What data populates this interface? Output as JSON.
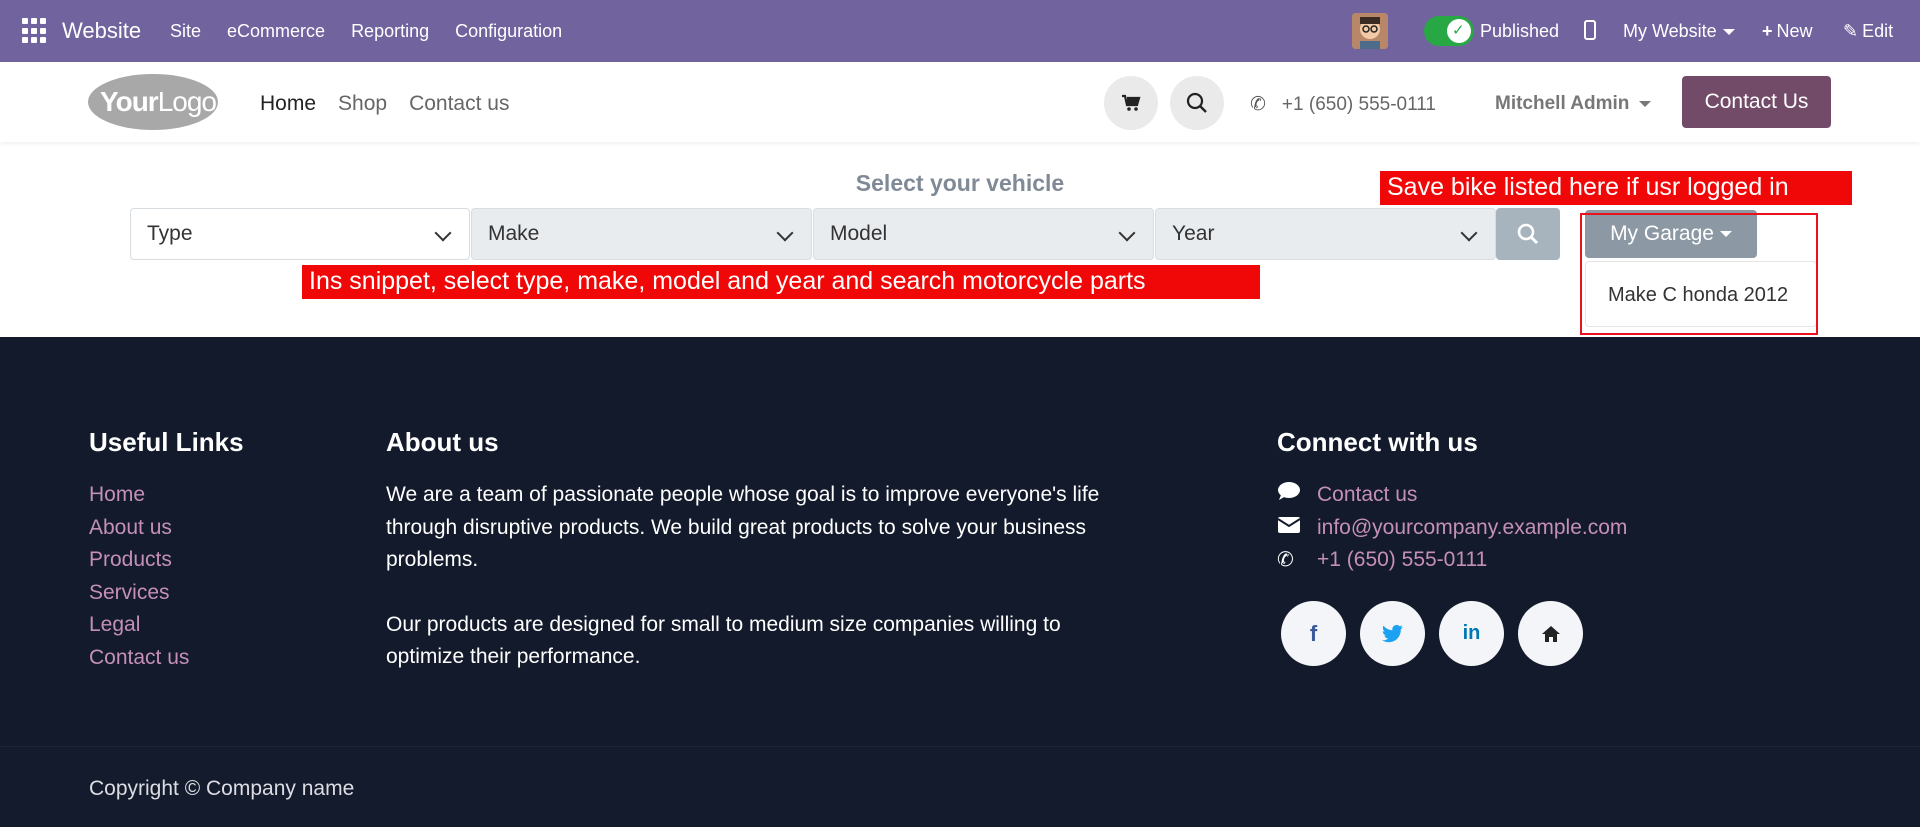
{
  "admin_bar": {
    "app_name": "Website",
    "menu": [
      "Site",
      "eCommerce",
      "Reporting",
      "Configuration"
    ],
    "published_label": "Published",
    "website_label": "My Website",
    "new_label": "New",
    "edit_label": "Edit",
    "bar_color": "#71639e"
  },
  "site_header": {
    "logo_text_bold": "Your",
    "logo_text_thin": "Logo",
    "nav": [
      "Home",
      "Shop",
      "Contact us"
    ],
    "phone": "+1 (650) 555-0111",
    "user": "Mitchell Admin",
    "contact_button": "Contact Us",
    "brand_color": "#714b67"
  },
  "vehicle_selector": {
    "title": "Select your vehicle",
    "type_placeholder": "Type",
    "make_placeholder": "Make",
    "model_placeholder": "Model",
    "year_placeholder": "Year",
    "garage_button": "My Garage",
    "garage_items": [
      "Make C honda 2012"
    ]
  },
  "annotations": {
    "garage_note": "Save bike listed here if usr logged in",
    "snippet_note": "Ins snippet, select type, make, model and year and search motorcycle parts",
    "color": "#f00707"
  },
  "footer": {
    "useful_links_title": "Useful Links",
    "useful_links": [
      "Home",
      "About us",
      "Products",
      "Services",
      "Legal",
      "Contact us"
    ],
    "about_title": "About us",
    "about_paragraphs": [
      "We are a team of passionate people whose goal is to improve everyone's life through disruptive products. We build great products to solve your business problems.",
      "Our products are designed for small to medium size companies willing to optimize their performance."
    ],
    "connect_title": "Connect with us",
    "connect_items": [
      "Contact us",
      "info@yourcompany.example.com",
      "+1 (650) 555-0111"
    ],
    "social_icons": [
      "facebook-icon",
      "twitter-icon",
      "linkedin-icon",
      "home-icon"
    ],
    "copyright": "Copyright © Company name",
    "bg_color": "#131a2b"
  }
}
